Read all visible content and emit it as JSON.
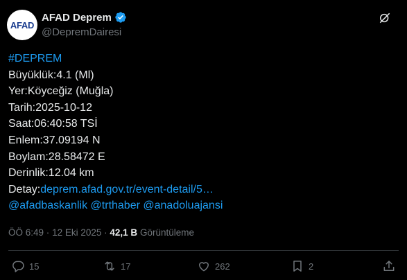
{
  "author": {
    "avatar_text": "AFAD",
    "display_name": "AFAD Deprem",
    "handle": "@DepremDairesi"
  },
  "body": {
    "hashtag": "#DEPREM",
    "lines": [
      "Büyüklük:4.1 (Ml)",
      "Yer:Köyceğiz (Muğla)",
      "Tarih:2025-10-12",
      "Saat:06:40:58 TSİ",
      "Enlem:37.09194 N",
      "Boylam:28.58472 E",
      "Derinlik:12.04 km"
    ],
    "detail_label": "Detay:",
    "detail_link": "deprem.afad.gov.tr/event-detail/5…",
    "mentions": [
      "@afadbaskanlik",
      "@trthaber",
      "@anadoluajansi"
    ]
  },
  "meta": {
    "time": "ÖÖ 6:49",
    "separator": "·",
    "date": "12 Eki 2025",
    "views_count": "42,1 B",
    "views_label": "Görüntüleme"
  },
  "actions": {
    "replies": "15",
    "retweets": "17",
    "likes": "262",
    "bookmarks": "2"
  },
  "colors": {
    "background": "#000000",
    "text": "#e7e9ea",
    "muted": "#71767b",
    "link": "#1d9bf0",
    "verified": "#1d9bf0"
  }
}
